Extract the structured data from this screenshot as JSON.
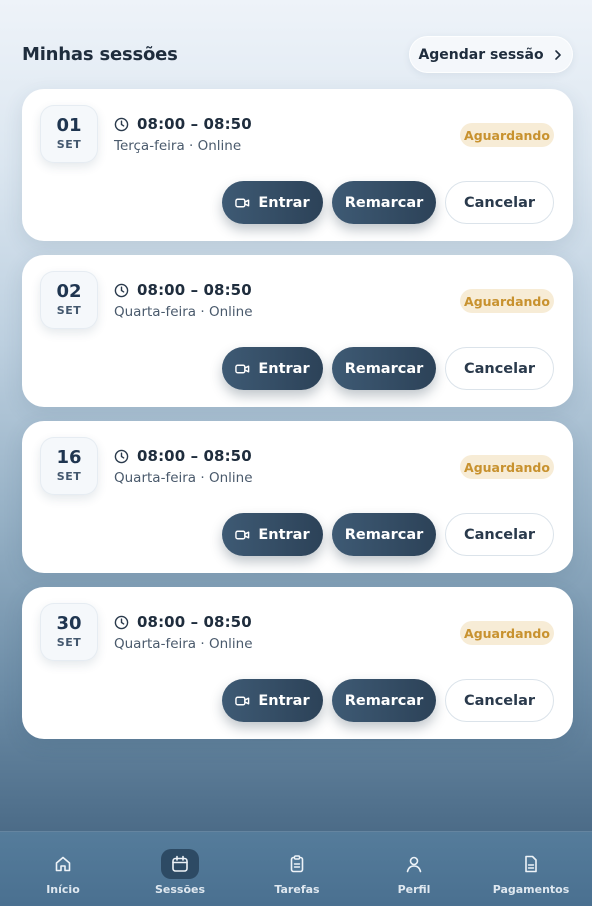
{
  "header": {
    "title": "Minhas sessões",
    "schedule_label": "Agendar sessão"
  },
  "sessions": [
    {
      "day": "01",
      "month": "SET",
      "time": "08:00 – 08:50",
      "detail": "Terça-feira · Online",
      "status": "Aguardando",
      "enter_label": "Entrar",
      "reschedule_label": "Remarcar",
      "cancel_label": "Cancelar"
    },
    {
      "day": "02",
      "month": "SET",
      "time": "08:00 – 08:50",
      "detail": "Quarta-feira · Online",
      "status": "Aguardando",
      "enter_label": "Entrar",
      "reschedule_label": "Remarcar",
      "cancel_label": "Cancelar"
    },
    {
      "day": "16",
      "month": "SET",
      "time": "08:00 – 08:50",
      "detail": "Quarta-feira · Online",
      "status": "Aguardando",
      "enter_label": "Entrar",
      "reschedule_label": "Remarcar",
      "cancel_label": "Cancelar"
    },
    {
      "day": "30",
      "month": "SET",
      "time": "08:00 – 08:50",
      "detail": "Quarta-feira · Online",
      "status": "Aguardando",
      "enter_label": "Entrar",
      "reschedule_label": "Remarcar",
      "cancel_label": "Cancelar"
    }
  ],
  "nav": {
    "items": [
      {
        "label": "Início",
        "icon": "home-icon"
      },
      {
        "label": "Sessões",
        "icon": "calendar-icon",
        "active": true
      },
      {
        "label": "Tarefas",
        "icon": "clipboard-icon"
      },
      {
        "label": "Perfil",
        "icon": "user-icon"
      },
      {
        "label": "Pagamentos",
        "icon": "document-icon"
      }
    ]
  },
  "colors": {
    "accent_dark": "#2c4258",
    "status_text": "#c8922f",
    "status_bg": "#f7ecd6"
  }
}
